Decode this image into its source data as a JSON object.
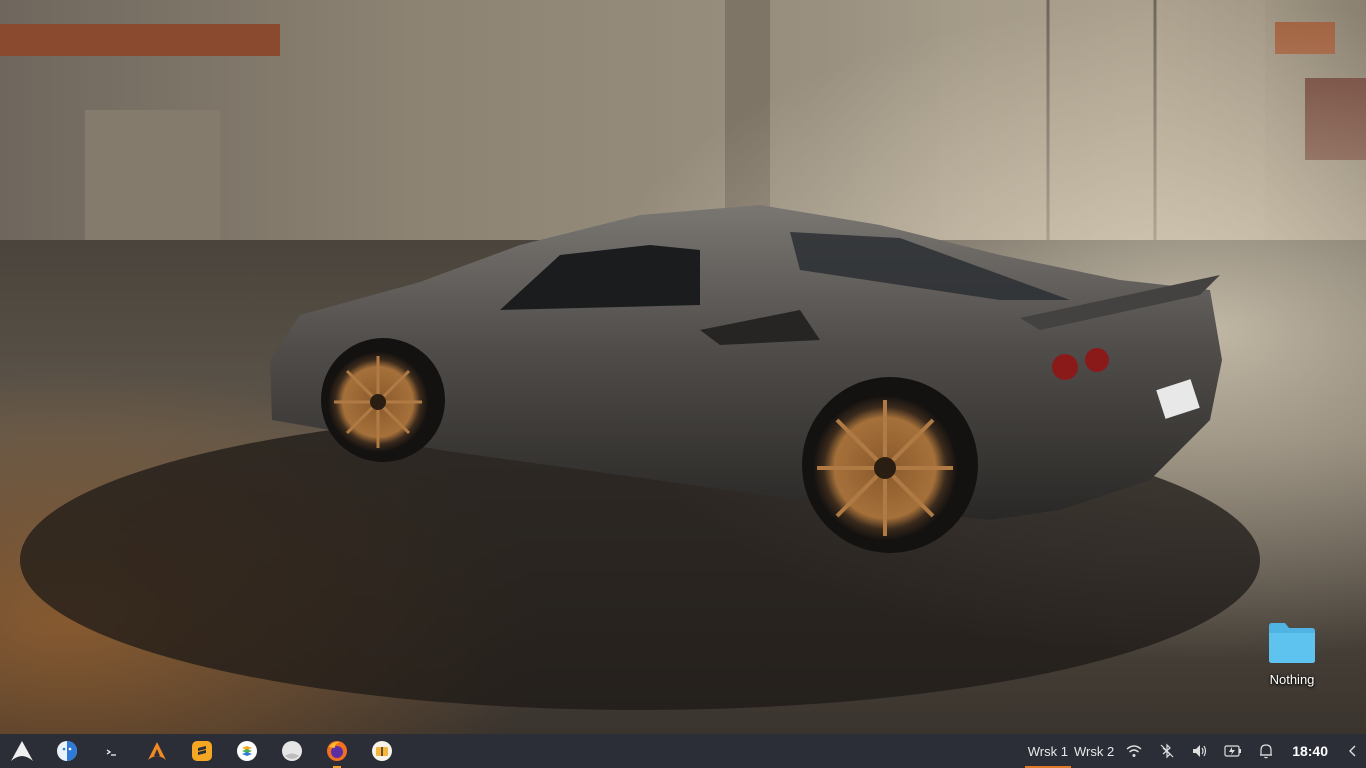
{
  "desktop": {
    "wallpaper": "sports-car-in-garage",
    "icons": [
      {
        "label": "Nothing",
        "icon": "folder-icon",
        "color": "#5fc3ef"
      }
    ]
  },
  "taskbar": {
    "background": "#2b2e36",
    "launcher_icon": "arch-linux-icon",
    "apps": [
      {
        "name": "file-manager-icon",
        "active": false
      },
      {
        "name": "terminal-icon",
        "active": false
      },
      {
        "name": "arch-icon",
        "active": false
      },
      {
        "name": "sublime-text-icon",
        "active": false
      },
      {
        "name": "stacks-icon",
        "active": false
      },
      {
        "name": "circle-app-icon",
        "active": false
      },
      {
        "name": "firefox-icon",
        "active": true
      },
      {
        "name": "archive-icon",
        "active": false
      }
    ],
    "workspaces": [
      {
        "label": "Wrsk 1",
        "active": true
      },
      {
        "label": "Wrsk 2",
        "active": false
      }
    ],
    "tray_icons": [
      "wifi-icon",
      "bluetooth-off-icon",
      "volume-icon",
      "battery-icon",
      "bell-icon"
    ],
    "clock": "18:40",
    "expand_icon": "chevron-left-icon",
    "accent": "#e07a2a"
  }
}
